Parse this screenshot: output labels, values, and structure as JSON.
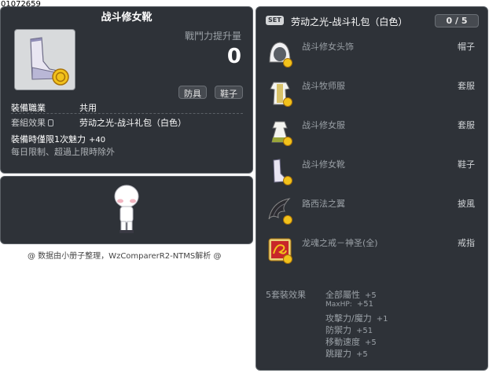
{
  "item_id": "01072659",
  "item": {
    "name": "战斗修女靴",
    "power_label": "戰鬥力提升量",
    "power_value": "0",
    "tags": [
      "防具",
      "鞋子"
    ],
    "job_label": "裝備職業",
    "job_value": "共用",
    "set_label": "套組效果",
    "set_name": "劳动之光-战斗礼包（白色）",
    "equip_limit_text": "裝備時僅限1次魅力",
    "equip_limit_value": "+40",
    "daily_limit_text": "每日限制、超過上限時除外"
  },
  "credit": "@ 数据由小册子整理，WzComparerR2-NTMS解析 @",
  "set_panel": {
    "badge": "SET",
    "title": "劳动之光-战斗礼包（白色）",
    "count": "0 / 5",
    "items": [
      {
        "name": "战斗修女头饰",
        "slot": "帽子",
        "icon": "hood-icon"
      },
      {
        "name": "战斗牧师服",
        "slot": "套服",
        "icon": "priest-robe-icon"
      },
      {
        "name": "战斗修女服",
        "slot": "套服",
        "icon": "nun-dress-icon"
      },
      {
        "name": "战斗修女靴",
        "slot": "鞋子",
        "icon": "boot-icon"
      },
      {
        "name": "路西法之翼",
        "slot": "披風",
        "icon": "dark-wing-icon"
      },
      {
        "name": "龙魂之戒－神圣(全)",
        "slot": "戒指",
        "icon": "dragon-ring-icon"
      }
    ],
    "bonus_label": "5套裝效果",
    "bonuses": [
      {
        "stat": "全部屬性",
        "value": "+5"
      },
      {
        "stat": "MaxHP:",
        "value": "+51"
      },
      {
        "stat": "攻擊力/魔力",
        "value": "+1"
      },
      {
        "stat": "防禦力",
        "value": "+51"
      },
      {
        "stat": "移動速度",
        "value": "+5"
      },
      {
        "stat": "跳躍力",
        "value": "+5"
      }
    ]
  },
  "colors": {
    "panel_bg": "#2e3238",
    "panel_border": "#5b6066",
    "text_dim": "#9aa0a6"
  }
}
